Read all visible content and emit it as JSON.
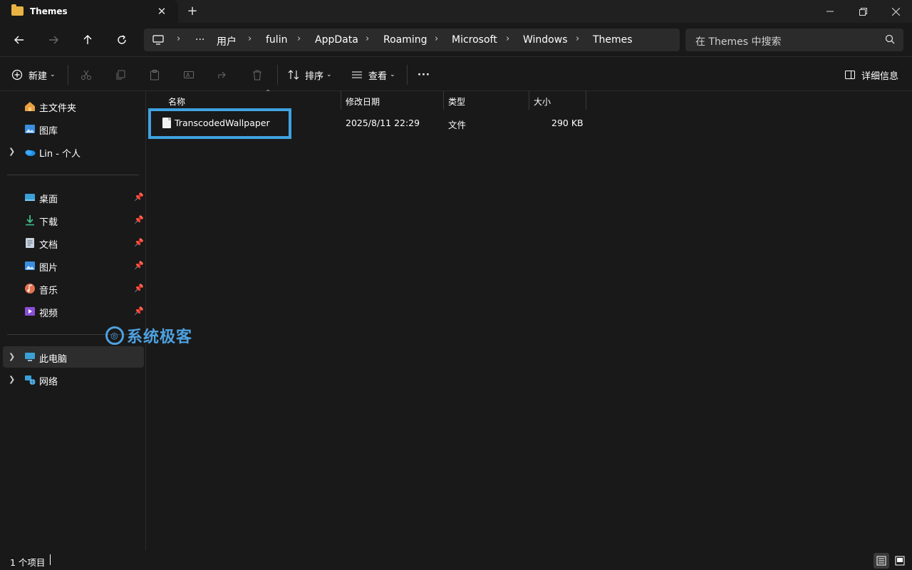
{
  "window": {
    "tab_title": "Themes",
    "new_tab": "+",
    "tab_close": "✕"
  },
  "address": {
    "overflow": "···",
    "segments": [
      "用户",
      "fulin",
      "AppData",
      "Roaming",
      "Microsoft",
      "Windows",
      "Themes"
    ],
    "search_placeholder": "在 Themes 中搜索"
  },
  "commands": {
    "new": "新建",
    "sort": "排序",
    "view": "查看",
    "more": "···",
    "details": "详细信息"
  },
  "sidebar": {
    "quick": [
      {
        "label": "主文件夹",
        "icon": "home-icon"
      },
      {
        "label": "图库",
        "icon": "gallery-icon"
      },
      {
        "label": "Lin - 个人",
        "icon": "onedrive-icon"
      }
    ],
    "pinned": [
      {
        "label": "桌面",
        "icon": "desktop-icon"
      },
      {
        "label": "下载",
        "icon": "download-icon"
      },
      {
        "label": "文档",
        "icon": "documents-icon"
      },
      {
        "label": "图片",
        "icon": "pictures-icon"
      },
      {
        "label": "音乐",
        "icon": "music-icon"
      },
      {
        "label": "视频",
        "icon": "videos-icon"
      }
    ],
    "devices": [
      {
        "label": "此电脑",
        "icon": "pc-icon"
      },
      {
        "label": "网络",
        "icon": "network-icon"
      }
    ]
  },
  "table": {
    "columns": [
      "名称",
      "修改日期",
      "类型",
      "大小"
    ],
    "rows": [
      {
        "name": "TranscodedWallpaper",
        "modified": "2025/8/11 22:29",
        "type": "文件",
        "size": "290 KB"
      }
    ]
  },
  "status": {
    "count": "1 个项目"
  },
  "watermark": "系统极客",
  "colors": {
    "highlight": "#3fa3e0",
    "folder": "#e9b343",
    "background": "#191919"
  }
}
